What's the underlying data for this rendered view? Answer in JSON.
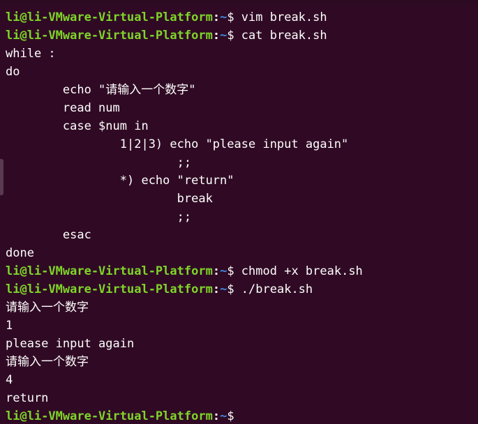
{
  "colors": {
    "background": "#300a24",
    "user_host": "#7fd52a",
    "path": "#3d8be0",
    "text": "#ffffff"
  },
  "prompt": {
    "user_host": "li@li-VMware-Virtual-Platform",
    "separator": ":",
    "path": "~",
    "symbol": "$ "
  },
  "lines": {
    "l01_cmd": "vim break.sh",
    "l02_cmd": "cat break.sh",
    "l03": "while :",
    "l04": "do",
    "l05": "        echo \"请输入一个数字\"",
    "l06": "        read num",
    "l07": "        case $num in",
    "l08": "                1|2|3) echo \"please input again\"",
    "l09": "                        ;;",
    "l10": "                *) echo \"return\"",
    "l11": "                        break",
    "l12": "                        ;;",
    "l13": "        esac",
    "l14": "done",
    "l15_cmd": "chmod +x break.sh",
    "l16_cmd": "./break.sh",
    "l17": "请输入一个数字",
    "l18": "1",
    "l19": "please input again",
    "l20": "请输入一个数字",
    "l21": "4",
    "l22": "return",
    "l23_cmd": ""
  }
}
